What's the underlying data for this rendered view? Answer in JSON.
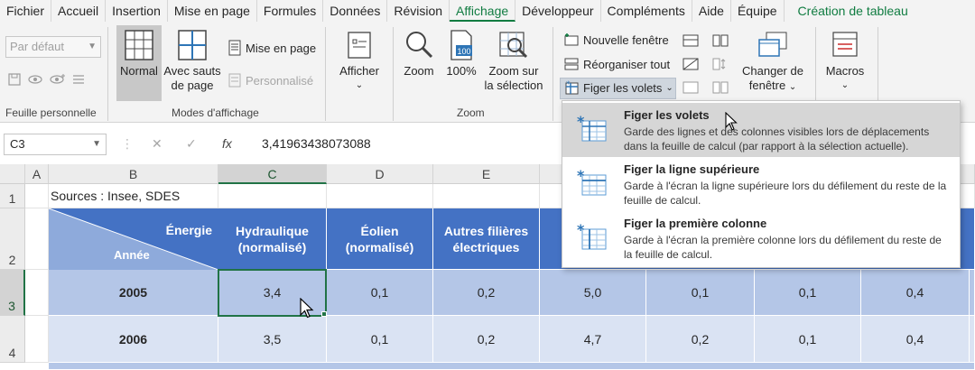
{
  "menu_tabs": [
    "Fichier",
    "Accueil",
    "Insertion",
    "Mise en page",
    "Formules",
    "Données",
    "Révision",
    "Affichage",
    "Développeur",
    "Compléments",
    "Aide",
    "Équipe",
    "Création de tableau"
  ],
  "active_tab": "Affichage",
  "ribbon": {
    "feuille_perso": {
      "dropdown_value": "Par défaut",
      "label": "Feuille personnelle"
    },
    "modes": {
      "normal": "Normal",
      "sauts_line1": "Avec sauts",
      "sauts_line2": "de page",
      "mise_en_page": "Mise en page",
      "personnalise": "Personnalisé",
      "label": "Modes d'affichage"
    },
    "afficher": "Afficher",
    "zoom": {
      "zoom": "Zoom",
      "cent": "100%",
      "selection_line1": "Zoom sur",
      "selection_line2": "la sélection",
      "label": "Zoom"
    },
    "fenetre": {
      "nouvelle": "Nouvelle fenêtre",
      "reorganiser": "Réorganiser tout",
      "figer": "Figer les volets",
      "changer_line1": "Changer de",
      "changer_line2": "fenêtre"
    },
    "macros": "Macros"
  },
  "formula_bar": {
    "name_box": "C3",
    "cancel_symbol": "✕",
    "enter_symbol": "✓",
    "fx_symbol": "fx",
    "value": "3,41963438073088"
  },
  "grid": {
    "columns": [
      "A",
      "B",
      "C",
      "D",
      "E"
    ],
    "rows": [
      "1",
      "2",
      "3",
      "4"
    ],
    "source": "Sources : Insee, SDES",
    "corner_energie": "Énergie",
    "corner_annee": "Année",
    "headers": [
      {
        "line1": "Hydraulique",
        "line2": "(normalisé)"
      },
      {
        "line1": "Éolien",
        "line2": "(normalisé)"
      },
      {
        "line1": "Autres filières",
        "line2": "électriques"
      }
    ],
    "data_rows": [
      {
        "year": "2005",
        "values": [
          "3,4",
          "0,1",
          "0,2",
          "5,0",
          "0,1",
          "0,1",
          "0,4"
        ]
      },
      {
        "year": "2006",
        "values": [
          "3,5",
          "0,1",
          "0,2",
          "4,7",
          "0,2",
          "0,1",
          "0,4"
        ]
      }
    ]
  },
  "figer_menu": {
    "items": [
      {
        "title": "Figer les volets",
        "desc": "Garde des lignes et des colonnes visibles lors de déplacements dans la feuille de calcul (par rapport à la sélection actuelle)."
      },
      {
        "title": "Figer la ligne supérieure",
        "desc": "Garde à l'écran la ligne supérieure lors du défilement du reste de la feuille de calcul."
      },
      {
        "title": "Figer la première colonne",
        "desc": "Garde à l'écran la première colonne lors du défilement du reste de la feuille de calcul."
      }
    ]
  },
  "colors": {
    "accent": "#107c41",
    "header_blue": "#4472c4",
    "row_dark": "#b4c6e7",
    "row_light": "#dae3f3"
  }
}
